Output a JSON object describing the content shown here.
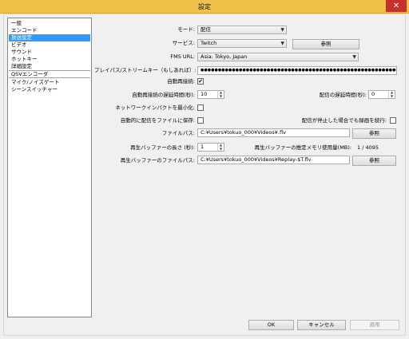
{
  "window": {
    "title": "設定",
    "close_glyph": "✕"
  },
  "sidebar": {
    "items": [
      {
        "label": "一般"
      },
      {
        "label": "エンコード"
      },
      {
        "label": "放送設定"
      },
      {
        "label": "ビデオ"
      },
      {
        "label": "サウンド"
      },
      {
        "label": "ホットキー"
      },
      {
        "label": "詳細設定"
      },
      {
        "label": "QSVエンコーダ"
      },
      {
        "label": "マイク/ノイズゲート"
      },
      {
        "label": "シーンスイッチャー"
      }
    ]
  },
  "form": {
    "mode_label": "モード:",
    "mode_value": "配信",
    "service_label": "サービス:",
    "service_value": "Twitch",
    "browse_label": "参照",
    "fms_label": "FMS URL:",
    "fms_value": "Asia: Tokyo, Japan",
    "stream_key_label": "プレイパス/ストリームキー（もしあれば）:",
    "stream_key_value": "●●●●●●●●●●●●●●●●●●●●●●●●●●●●●●●●●●●●●●●●●●●●●●●●●●●●●●●●●●●●●●●●●●●●●●●●●●●●",
    "auto_reconnect_label": "自動再接続:",
    "auto_reconnect_checked": true,
    "reconnect_delay_label": "自動再接続の遅延時間(秒):",
    "reconnect_delay_value": "10",
    "stream_delay_label": "配信の遅延時間(秒):",
    "stream_delay_value": "0",
    "minimize_impact_label": "ネットワークインパクトを最小化:",
    "save_to_file_label": "自動的に配信をファイルに保存:",
    "keep_recording_label": "配信が停止した場合でも録画を続行:",
    "file_path_label": "ファイルパス:",
    "file_path_value": "C:¥Users¥tokuo_000¥Videos¥.flv",
    "file_browse_label": "参照",
    "replay_length_label": "再生バッファーの長さ (秒):",
    "replay_length_value": "1",
    "replay_memory_label": "再生バッファーの推定メモリ使用量(MB):",
    "replay_memory_value": "1 / 4095",
    "replay_path_label": "再生バッファーのファイルパス:",
    "replay_path_value": "C:¥Users¥tokuo_000¥Videos¥Replay-$T.flv",
    "replay_browse_label": "参照",
    "check_glyph": "✔",
    "dropdown_glyph": "▼",
    "spin_up_glyph": "▲",
    "spin_down_glyph": "▼"
  },
  "footer": {
    "ok_label": "OK",
    "cancel_label": "キャンセル",
    "apply_label": "適用"
  }
}
